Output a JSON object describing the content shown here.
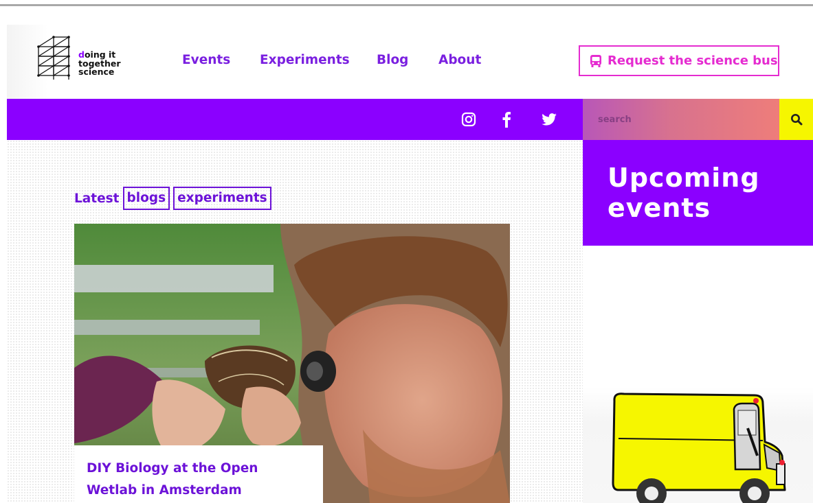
{
  "logo": {
    "line1_accent": "d",
    "line1_rest": "oing it",
    "line2": "together",
    "line3": "science",
    "accent_color": "#8b00ff"
  },
  "nav": {
    "items": [
      {
        "label": "Events"
      },
      {
        "label": "Experiments"
      },
      {
        "label": "Blog"
      },
      {
        "label": "About"
      }
    ]
  },
  "bus_request": {
    "label": "Request the science bus",
    "icon": "bus-icon",
    "color": "#e52bd0"
  },
  "social": {
    "icons": [
      "instagram-icon",
      "facebook-icon",
      "twitter-icon"
    ]
  },
  "search": {
    "placeholder": "search",
    "icon": "search-icon"
  },
  "latest": {
    "prefix": "Latest",
    "tags": [
      "blogs",
      "experiments"
    ]
  },
  "featured_post": {
    "title": "DIY Biology at the Open Wetlab in Amsterdam"
  },
  "sidebar": {
    "heading": "Upcoming events"
  },
  "colors": {
    "brand_purple": "#8b00ff",
    "link_purple": "#6c12d8",
    "search_button": "#f6f600"
  }
}
